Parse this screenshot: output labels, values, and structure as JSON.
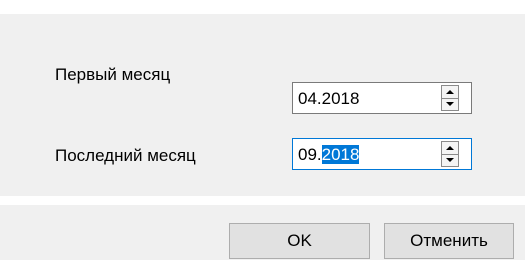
{
  "form": {
    "first_month": {
      "label": "Первый месяц",
      "value": "04.2018"
    },
    "last_month": {
      "label": "Последний месяц",
      "value_prefix": "09.",
      "value_selected": "2018"
    }
  },
  "buttons": {
    "ok_label": "OK",
    "cancel_label": "Отменить"
  },
  "colors": {
    "window_bg": "#f0f0f0",
    "selection": "#0078d7",
    "focus_border": "#0078d7",
    "button_bg": "#e1e1e1"
  },
  "icons": {
    "spin_up": "triangle-up",
    "spin_down": "triangle-down"
  }
}
